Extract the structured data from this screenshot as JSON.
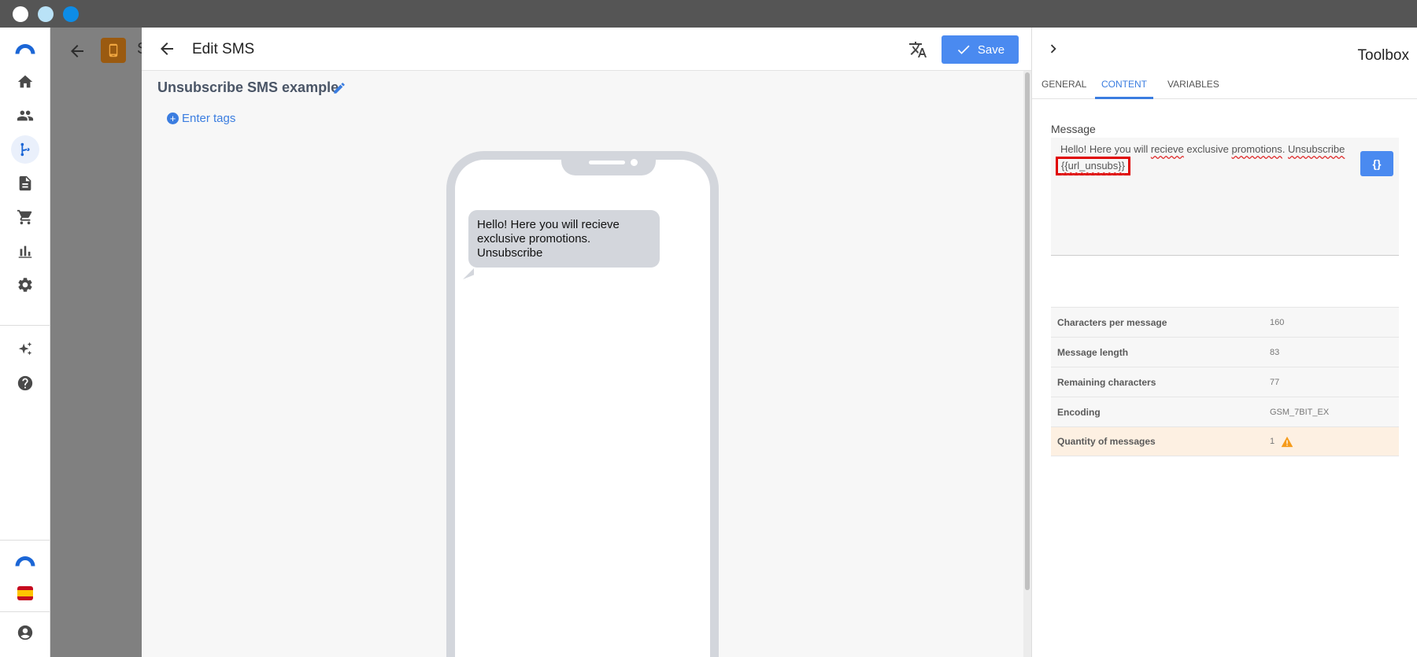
{
  "window": {
    "controls": [
      "close",
      "minimize",
      "maximize"
    ]
  },
  "leftnav": {
    "items": [
      {
        "icon": "home-icon"
      },
      {
        "icon": "users-icon"
      },
      {
        "icon": "flow-icon",
        "active": true
      },
      {
        "icon": "document-icon"
      },
      {
        "icon": "cart-icon"
      },
      {
        "icon": "chart-icon"
      },
      {
        "icon": "gear-icon"
      },
      {
        "icon": "sparkles-icon"
      },
      {
        "icon": "help-icon"
      }
    ],
    "bottom": [
      "brand-logo",
      "spanish-flag-icon",
      "account-icon"
    ]
  },
  "background_page": {
    "letter": "S"
  },
  "editor": {
    "title": "Edit SMS",
    "save_label": "Save",
    "template_name": "Unsubscribe SMS example",
    "tags_label": "Enter tags",
    "preview_message": "Hello! Here you will recieve exclusive promotions. Unsubscribe"
  },
  "toolbox": {
    "title": "Toolbox",
    "tabs": [
      {
        "label": "GENERAL",
        "active": false
      },
      {
        "label": "CONTENT",
        "active": true
      },
      {
        "label": "VARIABLES",
        "active": false
      }
    ],
    "message_label": "Message",
    "message_parts": {
      "p1": "Hello! Here you will ",
      "p2": "recieve",
      "p3": " exclusive ",
      "p4": "promotions",
      "p5": ". ",
      "p6": "Unsubscribe",
      "variable": "{{url_unsubs}}"
    },
    "variable_button": "{}",
    "stats": [
      {
        "label": "Characters per message",
        "value": "160"
      },
      {
        "label": "Message length",
        "value": "83"
      },
      {
        "label": "Remaining characters",
        "value": "77"
      },
      {
        "label": "Encoding",
        "value": "GSM_7BIT_EX"
      },
      {
        "label": "Quantity of messages",
        "value": "1",
        "warning": true
      }
    ]
  },
  "colors": {
    "accent": "#4a8af0",
    "warning_row": "#fdf0e2",
    "warning_icon": "#f59b1b",
    "highlight_box": "#e00000"
  }
}
